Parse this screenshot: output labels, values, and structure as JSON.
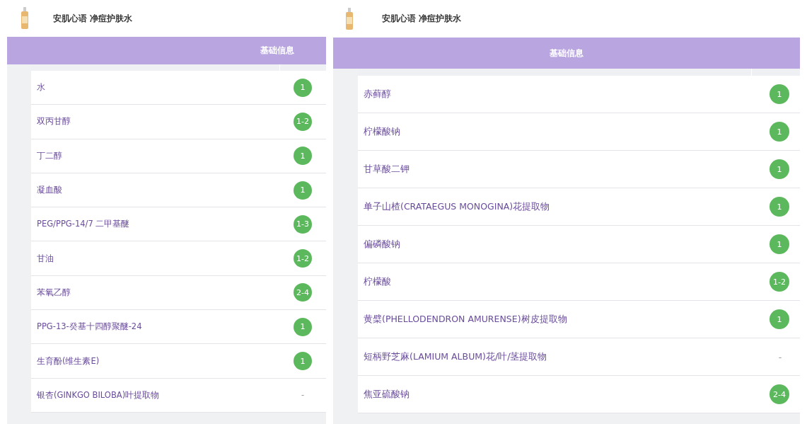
{
  "panels": [
    {
      "product_title": "安肌心语 净痘护肤水",
      "section_header": "基础信息",
      "rows": [
        {
          "name": "水",
          "kind": "badge",
          "score": "1"
        },
        {
          "name": "双丙甘醇",
          "kind": "badge",
          "score": "1-2"
        },
        {
          "name": "丁二醇",
          "kind": "badge",
          "score": "1"
        },
        {
          "name": "凝血酸",
          "kind": "badge",
          "score": "1"
        },
        {
          "name": "PEG/PPG-14/7 二甲基醚",
          "kind": "badge",
          "score": "1-3"
        },
        {
          "name": "甘油",
          "kind": "badge",
          "score": "1-2"
        },
        {
          "name": "苯氧乙醇",
          "kind": "badge",
          "score": "2-4"
        },
        {
          "name": "PPG-13-癸基十四醇聚醚-24",
          "kind": "badge",
          "score": "1"
        },
        {
          "name": "生育酚(维生素E)",
          "kind": "badge",
          "score": "1"
        },
        {
          "name": "银杏(GINKGO BILOBA)叶提取物",
          "kind": "plain",
          "score": "-"
        }
      ]
    },
    {
      "product_title": "安肌心语 净痘护肤水",
      "section_header": "基础信息",
      "rows": [
        {
          "name": "赤藓醇",
          "kind": "badge",
          "score": "1"
        },
        {
          "name": "柠檬酸钠",
          "kind": "badge",
          "score": "1"
        },
        {
          "name": "甘草酸二钾",
          "kind": "badge",
          "score": "1"
        },
        {
          "name": "单子山楂(CRATAEGUS MONOGINA)花提取物",
          "kind": "badge",
          "score": "1"
        },
        {
          "name": "偏磷酸钠",
          "kind": "badge",
          "score": "1"
        },
        {
          "name": "柠檬酸",
          "kind": "badge",
          "score": "1-2"
        },
        {
          "name": "黄檗(PHELLODENDRON AMURENSE)树皮提取物",
          "kind": "badge",
          "score": "1"
        },
        {
          "name": "短柄野芝麻(LAMIUM ALBUM)花/叶/茎提取物",
          "kind": "plain",
          "score": "-"
        },
        {
          "name": "焦亚硫酸钠",
          "kind": "badge",
          "score": "2-4"
        }
      ]
    }
  ]
}
